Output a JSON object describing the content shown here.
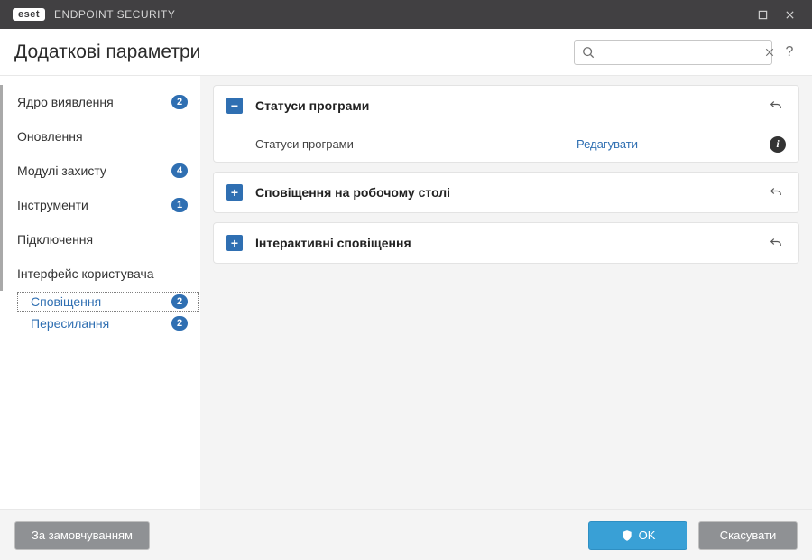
{
  "titlebar": {
    "brand_badge": "eset",
    "brand_name": "ENDPOINT SECURITY"
  },
  "header": {
    "title": "Додаткові параметри",
    "search_placeholder": "",
    "help": "?"
  },
  "sidebar": {
    "items": [
      {
        "label": "Ядро виявлення",
        "badge": "2",
        "bar": true
      },
      {
        "label": "Оновлення",
        "badge": "",
        "bar": true
      },
      {
        "label": "Модулі захисту",
        "badge": "4",
        "bar": true
      },
      {
        "label": "Інструменти",
        "badge": "1",
        "bar": true
      },
      {
        "label": "Підключення",
        "badge": "",
        "bar": true
      },
      {
        "label": "Інтерфейс користувача",
        "badge": "",
        "bar": true
      }
    ],
    "sub": [
      {
        "label": "Сповіщення",
        "badge": "2",
        "selected": true
      },
      {
        "label": "Пересилання",
        "badge": "2",
        "selected": false
      }
    ]
  },
  "panels": [
    {
      "expanded": true,
      "title": "Статуси програми",
      "rows": [
        {
          "label": "Статуси програми",
          "action": "Редагувати",
          "info": true
        }
      ]
    },
    {
      "expanded": false,
      "title": "Сповіщення на робочому столі",
      "rows": []
    },
    {
      "expanded": false,
      "title": "Інтерактивні сповіщення",
      "rows": []
    }
  ],
  "footer": {
    "default": "За замовчуванням",
    "ok": "OK",
    "cancel": "Скасувати"
  }
}
